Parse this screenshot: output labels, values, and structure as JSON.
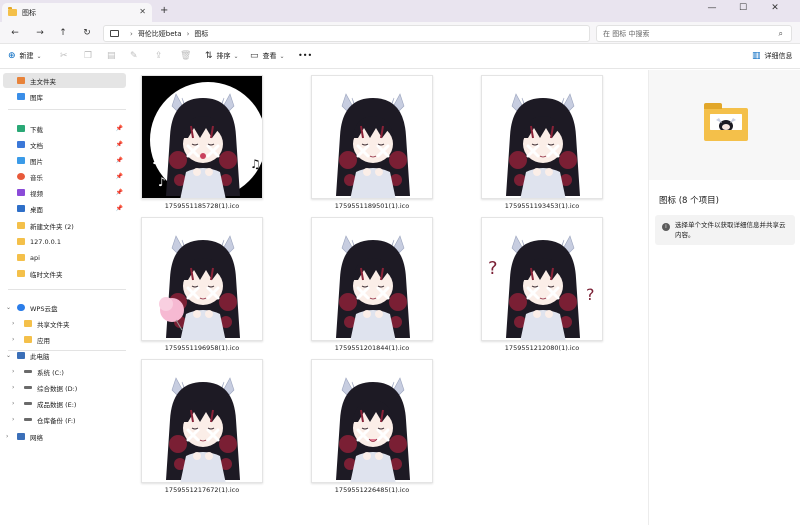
{
  "window": {
    "tab_title": "图标",
    "new_tab": "+",
    "close_tab": "✕",
    "minimize": "—",
    "maximize": "☐",
    "close": "✕"
  },
  "address": {
    "crumbs": [
      "哥伦比娅beta",
      "图标"
    ],
    "search_placeholder": "在 图标 中搜索"
  },
  "toolbar": {
    "new_label": "新建",
    "sort_label": "排序",
    "view_label": "查看",
    "more_label": "•••",
    "details_label": "详细信息"
  },
  "sidebar": {
    "items": [
      {
        "label": "主文件夹",
        "icon": "home-icon",
        "color": "#e8833a"
      },
      {
        "label": "图库",
        "icon": "gallery-icon",
        "color": "#3a8ee8"
      },
      {
        "label": "下载",
        "icon": "download-icon",
        "color": "#2aa876"
      },
      {
        "label": "文档",
        "icon": "document-icon",
        "color": "#3b78d8"
      },
      {
        "label": "图片",
        "icon": "pictures-icon",
        "color": "#3b9be8"
      },
      {
        "label": "音乐",
        "icon": "music-icon",
        "color": "#e85a3b"
      },
      {
        "label": "视频",
        "icon": "video-icon",
        "color": "#8b4bd8"
      },
      {
        "label": "桌面",
        "icon": "desktop-icon",
        "color": "#2f6fc8"
      },
      {
        "label": "新建文件夹 (2)",
        "icon": "folder-icon",
        "color": "#f4c04a"
      },
      {
        "label": "127.0.0.1",
        "icon": "folder-icon",
        "color": "#f4c04a"
      },
      {
        "label": "api",
        "icon": "folder-icon",
        "color": "#f4c04a"
      },
      {
        "label": "临时文件夹",
        "icon": "folder-icon",
        "color": "#f4c04a"
      },
      {
        "label": "WPS云盘",
        "icon": "cloud-icon",
        "color": "#2b7de9"
      },
      {
        "label": "共享文件夹",
        "icon": "folder-icon",
        "color": "#f4c04a"
      },
      {
        "label": "应用",
        "icon": "folder-icon",
        "color": "#f4c04a"
      },
      {
        "label": "此电脑",
        "icon": "computer-icon",
        "color": "#3b6fb8"
      },
      {
        "label": "系统 (C:)",
        "icon": "drive-icon",
        "color": "#6a6a6a"
      },
      {
        "label": "综合数据 (D:)",
        "icon": "drive-icon",
        "color": "#6a6a6a"
      },
      {
        "label": "成品数据 (E:)",
        "icon": "drive-icon",
        "color": "#6a6a6a"
      },
      {
        "label": "仓库备份 (F:)",
        "icon": "drive-icon",
        "color": "#6a6a6a"
      },
      {
        "label": "网络",
        "icon": "network-icon",
        "color": "#3b6fb8"
      }
    ]
  },
  "files": [
    {
      "name": "1759551185728(1).ico",
      "bg": "#000000",
      "expression": "singing"
    },
    {
      "name": "1759551189501(1).ico",
      "bg": "#ffffff",
      "expression": "calm"
    },
    {
      "name": "1759551193453(1).ico",
      "bg": "#ffffff",
      "expression": "sleepy"
    },
    {
      "name": "1759551196958(1).ico",
      "bg": "#ffffff",
      "expression": "cotton-candy"
    },
    {
      "name": "1759551201844(1).ico",
      "bg": "#ffffff",
      "expression": "calm"
    },
    {
      "name": "1759551212080(1).ico",
      "bg": "#ffffff",
      "expression": "confused"
    },
    {
      "name": "1759551217672(1).ico",
      "bg": "#ffffff",
      "expression": "calm"
    },
    {
      "name": "1759551226485(1).ico",
      "bg": "#ffffff",
      "expression": "tongue"
    }
  ],
  "details": {
    "title": "图标 (8 个项目)",
    "info": "选择单个文件以获取详细信息并共享云内容。"
  }
}
